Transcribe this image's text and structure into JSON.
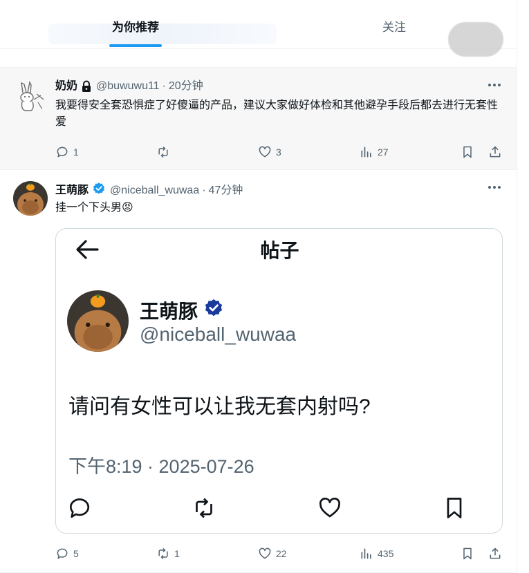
{
  "tabs": [
    {
      "label": "为你推荐",
      "active": true
    },
    {
      "label": "关注",
      "active": false
    }
  ],
  "posts": [
    {
      "name": "奶奶",
      "locked": true,
      "handle": "@buwuwu11",
      "separator": "·",
      "time": "20分钟",
      "text": "我要得安全套恐惧症了好傻逼的产品，建议大家做好体检和其他避孕手段后都去进行无套性爱",
      "replies": "1",
      "reposts": "",
      "likes": "3",
      "views": "27"
    },
    {
      "name": "王萌豚",
      "verified": true,
      "handle": "@niceball_wuwaa",
      "separator": "·",
      "time": "47分钟",
      "text": "挂一个下头男😡",
      "replies": "5",
      "reposts": "1",
      "likes": "22",
      "views": "435",
      "screenshot": {
        "title": "帖子",
        "name": "王萌豚",
        "handle": "@niceball_wuwaa",
        "text": "请问有女性可以让我无套内射吗?",
        "timestamp": "下午8:19 · 2025-07-26"
      }
    }
  ],
  "colors": {
    "accent": "#1d9bf0",
    "text": "#0f1419",
    "secondary": "#536471",
    "verified": "#1d9bf0",
    "highlight_bg": "#f7f7f7"
  },
  "icons": [
    "lock-icon",
    "verified-badge-icon",
    "more-icon",
    "reply-icon",
    "repost-icon",
    "like-icon",
    "views-icon",
    "bookmark-icon",
    "share-icon",
    "back-arrow-icon"
  ]
}
